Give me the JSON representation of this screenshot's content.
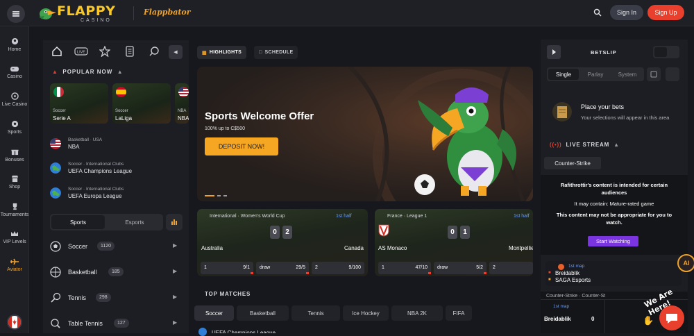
{
  "header": {
    "logo_text": "FLAPPY",
    "logo_sub": "CASINO",
    "partner_logo": "Flappbator",
    "search_icon": "search-icon",
    "signin_label": "Sign In",
    "signup_label": "Sign Up",
    "accent": "#e8402c"
  },
  "leftnav": {
    "items": [
      {
        "label": "Home",
        "icon": "home-icon"
      },
      {
        "label": "Casino",
        "icon": "gamepad-icon"
      },
      {
        "label": "Live Casino",
        "icon": "roulette-icon"
      },
      {
        "label": "Sports",
        "icon": "soccer-ball-icon"
      },
      {
        "label": "Bonuses",
        "icon": "gift-icon"
      },
      {
        "label": "Shop",
        "icon": "shop-icon"
      },
      {
        "label": "Tournaments",
        "icon": "trophy-icon"
      },
      {
        "label": "VIP Levels",
        "icon": "crown-icon"
      },
      {
        "label": "Aviator",
        "icon": "plane-icon"
      }
    ]
  },
  "sports_panel": {
    "live_label": "LIVE",
    "popular_label": "POPULAR NOW",
    "popular_cards": [
      {
        "sport": "Soccer",
        "league": "Serie A"
      },
      {
        "sport": "Soccer",
        "league": "LaLiga"
      },
      {
        "sport": "NBA",
        "league": "NBA"
      }
    ],
    "leagues": [
      {
        "category": "Basketball · USA",
        "name": "NBA"
      },
      {
        "category": "Soccer · International Clubs",
        "name": "UEFA Champions League"
      },
      {
        "category": "Soccer · International Clubs",
        "name": "UEFA Europa League"
      }
    ],
    "tabs": {
      "sports": "Sports",
      "esports": "Esports"
    },
    "sports": [
      {
        "name": "Soccer",
        "count": "1120"
      },
      {
        "name": "Basketball",
        "count": "185"
      },
      {
        "name": "Tennis",
        "count": "298"
      },
      {
        "name": "Table Tennis",
        "count": "127"
      }
    ]
  },
  "main": {
    "tabs": {
      "highlights": "HIGHLIGHTS",
      "schedule": "SCHEDULE"
    },
    "hero": {
      "title": "Sports Welcome Offer",
      "subtitle": "100% up to C$500",
      "button": "DEPOSIT NOW!"
    },
    "matches": [
      {
        "league": "International · Women's World Cup",
        "half": "1st half",
        "home": "Australia",
        "away": "Canada",
        "score_home": "0",
        "score_away": "2",
        "odds": [
          {
            "l": "1",
            "r": "9/1"
          },
          {
            "l": "draw",
            "r": "29/5"
          },
          {
            "l": "2",
            "r": "9/100"
          }
        ]
      },
      {
        "league": "France · League 1",
        "half": "1st half",
        "home": "AS Monaco",
        "away": "Montpellier",
        "score_home": "0",
        "score_away": "1",
        "odds": [
          {
            "l": "1",
            "r": "47/10"
          },
          {
            "l": "draw",
            "r": "5/2"
          },
          {
            "l": "2",
            "r": ""
          }
        ]
      }
    ],
    "top_matches_label": "TOP MATCHES",
    "top_tabs": [
      "Soccer",
      "Basketball",
      "Tennis",
      "Ice Hockey",
      "NBA 2K",
      "FIFA"
    ],
    "peek_text": "UEFA Champions League"
  },
  "betslip": {
    "title": "BETSLIP",
    "tabs": [
      "Single",
      "Parlay",
      "System"
    ],
    "empty_title": "Place your bets",
    "empty_sub": "Your selections will appear in this area",
    "live_stream_label": "LIVE STREAM",
    "stream_game": "Counter-Strike",
    "notice_lines": [
      "Rafithrottir's content is intended for certain",
      "audiences",
      "It may contain: Mature-rated game",
      "This content may not be appropriate for you to",
      "watch."
    ],
    "watch_button": "Start Watching",
    "mini": {
      "map": "1st map",
      "team1": "Breidablik",
      "team2": "SAGA Esports"
    },
    "score_header": "Counter-Strike · Counter-St",
    "score_map": "1st map",
    "score_team": "Breidablik",
    "score_value": "0",
    "ai_label": "AI",
    "chat_tagline": "We Are Here!"
  }
}
